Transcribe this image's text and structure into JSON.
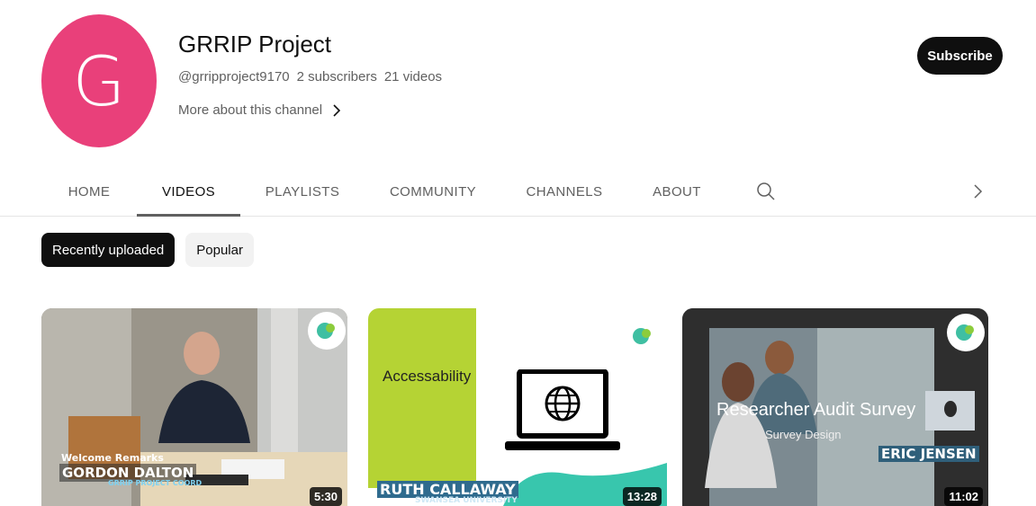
{
  "channel": {
    "avatar_letter": "G",
    "name": "GRRIP Project",
    "handle": "@grripproject9170",
    "subscribers": "2 subscribers",
    "videos": "21 videos",
    "more_label": "More about this channel",
    "subscribe_label": "Subscribe"
  },
  "tabs": [
    {
      "label": "HOME"
    },
    {
      "label": "VIDEOS"
    },
    {
      "label": "PLAYLISTS"
    },
    {
      "label": "COMMUNITY"
    },
    {
      "label": "CHANNELS"
    },
    {
      "label": "ABOUT"
    }
  ],
  "active_tab": "VIDEOS",
  "chips": [
    {
      "label": "Recently uploaded"
    },
    {
      "label": "Popular"
    }
  ],
  "videos": [
    {
      "duration": "5:30",
      "caption_top": "Welcome Remarks",
      "caption_name": "GORDON DALTON",
      "caption_role": "GRRIP PROJECT COORD"
    },
    {
      "duration": "13:28",
      "heading": "Accessability",
      "caption_name": "RUTH CALLAWAY",
      "caption_role": "SWANSEA UNIVERSITY"
    },
    {
      "duration": "11:02",
      "heading": "Researcher Audit Survey",
      "subheading": "Survey Design",
      "caption_name": "ERIC JENSEN"
    }
  ],
  "colors": {
    "avatar": "#e9407a",
    "text_primary": "#0f0f0f",
    "text_secondary": "#606060",
    "chip_bg": "#f2f2f2",
    "lime": "#b5d334"
  },
  "icons": [
    "chevron-right-icon",
    "search-icon",
    "globe-icon",
    "laptop-icon"
  ]
}
